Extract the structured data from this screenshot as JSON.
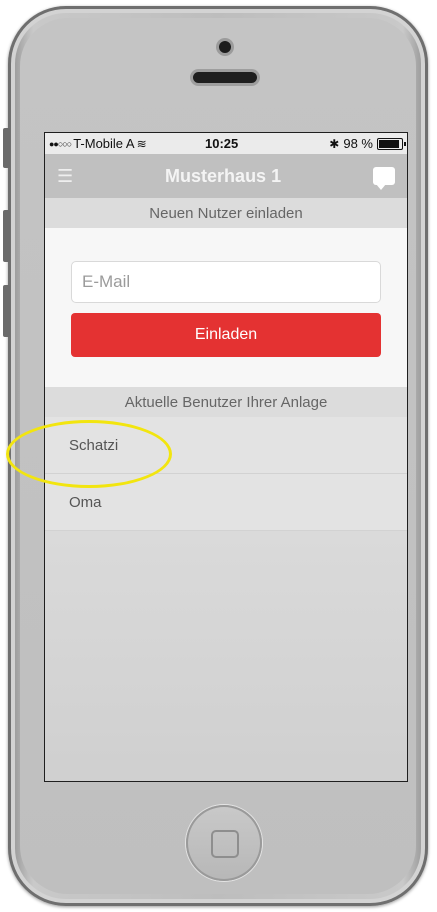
{
  "statusbar": {
    "carrier": "T-Mobile A",
    "time": "10:25",
    "battery": "98 %"
  },
  "navbar": {
    "title": "Musterhaus 1"
  },
  "invite_section": {
    "header": "Neuen Nutzer einladen",
    "email_placeholder": "E-Mail",
    "invite_button": "Einladen"
  },
  "users_section": {
    "header": "Aktuelle Benutzer Ihrer Anlage",
    "users": [
      "Schatzi",
      "Oma"
    ]
  },
  "colors": {
    "accent_red": "#e43232",
    "highlight_yellow": "#f2e50f",
    "navbar_gray": "#c0c0c0"
  }
}
